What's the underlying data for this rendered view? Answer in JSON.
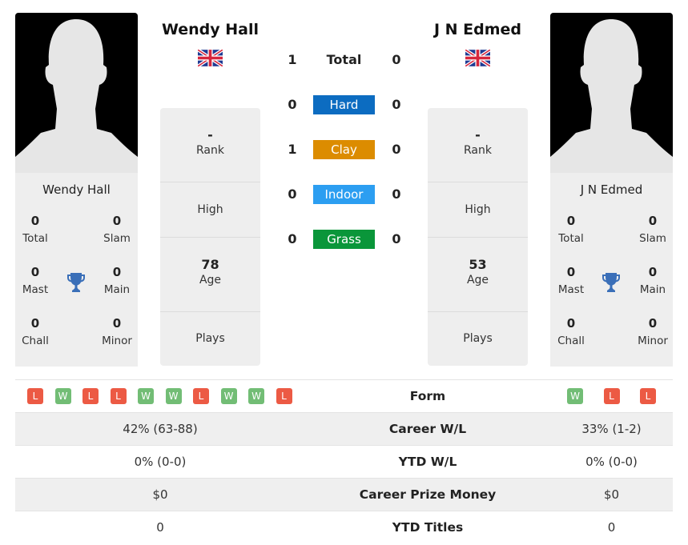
{
  "players": {
    "left": {
      "name": "Wendy Hall",
      "country_flag": "uk-flag",
      "card_name": "Wendy Hall",
      "titles": {
        "total": {
          "value": "0",
          "label": "Total"
        },
        "slam": {
          "value": "0",
          "label": "Slam"
        },
        "mast": {
          "value": "0",
          "label": "Mast"
        },
        "main": {
          "value": "0",
          "label": "Main"
        },
        "chall": {
          "value": "0",
          "label": "Chall"
        },
        "minor": {
          "value": "0",
          "label": "Minor"
        }
      },
      "info": {
        "rank": {
          "value": "-",
          "label": "Rank"
        },
        "high": {
          "value": "",
          "label": "High"
        },
        "age": {
          "value": "78",
          "label": "Age"
        },
        "plays": {
          "value": "",
          "label": "Plays"
        }
      },
      "form": [
        "L",
        "W",
        "L",
        "L",
        "W",
        "W",
        "L",
        "W",
        "W",
        "L"
      ]
    },
    "right": {
      "name": "J N Edmed",
      "country_flag": "uk-flag",
      "card_name": "J N Edmed",
      "titles": {
        "total": {
          "value": "0",
          "label": "Total"
        },
        "slam": {
          "value": "0",
          "label": "Slam"
        },
        "mast": {
          "value": "0",
          "label": "Mast"
        },
        "main": {
          "value": "0",
          "label": "Main"
        },
        "chall": {
          "value": "0",
          "label": "Chall"
        },
        "minor": {
          "value": "0",
          "label": "Minor"
        }
      },
      "info": {
        "rank": {
          "value": "-",
          "label": "Rank"
        },
        "high": {
          "value": "",
          "label": "High"
        },
        "age": {
          "value": "53",
          "label": "Age"
        },
        "plays": {
          "value": "",
          "label": "Plays"
        }
      },
      "form": [
        "W",
        "L",
        "L"
      ]
    }
  },
  "h2h": [
    {
      "label": "Total",
      "left": "1",
      "right": "0",
      "color": ""
    },
    {
      "label": "Hard",
      "left": "0",
      "right": "0",
      "color": "#0c6cc1"
    },
    {
      "label": "Clay",
      "left": "1",
      "right": "0",
      "color": "#dc8c00"
    },
    {
      "label": "Indoor",
      "left": "0",
      "right": "0",
      "color": "#2c9ef1"
    },
    {
      "label": "Grass",
      "left": "0",
      "right": "0",
      "color": "#0a963a"
    }
  ],
  "stats": {
    "form_label": "Form",
    "rows": [
      {
        "label": "Career W/L",
        "left": "42% (63-88)",
        "right": "33% (1-2)"
      },
      {
        "label": "YTD W/L",
        "left": "0% (0-0)",
        "right": "0% (0-0)"
      },
      {
        "label": "Career Prize Money",
        "left": "$0",
        "right": "$0"
      },
      {
        "label": "YTD Titles",
        "left": "0",
        "right": "0"
      }
    ]
  },
  "colors": {
    "win": "#72bd75",
    "loss": "#ec5a44",
    "trophy": "#3a6fb8",
    "card_bg": "#eeeeee"
  }
}
